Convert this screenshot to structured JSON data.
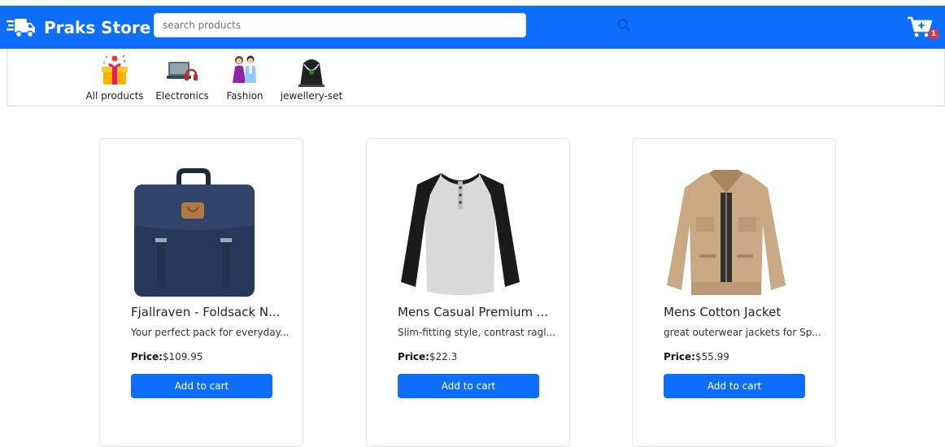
{
  "header": {
    "brand_name": "Praks Store",
    "logo_icon": "delivery-truck-icon",
    "search": {
      "placeholder": "search products",
      "value": "",
      "icon": "search-icon"
    },
    "cart": {
      "icon": "cart-plus-icon",
      "count": "1"
    }
  },
  "categories": [
    {
      "label": "All products",
      "icon": "gift-box-icon"
    },
    {
      "label": "Electronics",
      "icon": "laptop-headphones-icon"
    },
    {
      "label": "Fashion",
      "icon": "fashion-couple-icon"
    },
    {
      "label": "jewellery-set",
      "icon": "necklace-icon"
    }
  ],
  "products": [
    {
      "title": "Fjallraven - Foldsack N...",
      "description": "Your perfect pack for everyday...",
      "price_label": "Price:",
      "price": "$109.95",
      "button_label": "Add to cart",
      "image": "backpack-image"
    },
    {
      "title": "Mens Casual Premium ...",
      "description": "Slim-fitting style, contrast ragl...",
      "price_label": "Price:",
      "price": "$22.3",
      "button_label": "Add to cart",
      "image": "raglan-tshirt-image"
    },
    {
      "title": "Mens Cotton Jacket",
      "description": "great outerwear jackets for Sp...",
      "price_label": "Price:",
      "price": "$55.99",
      "button_label": "Add to cart",
      "image": "cotton-jacket-image"
    }
  ],
  "colors": {
    "primary": "#0d6efd",
    "badge": "#dc3545",
    "white": "#ffffff"
  }
}
